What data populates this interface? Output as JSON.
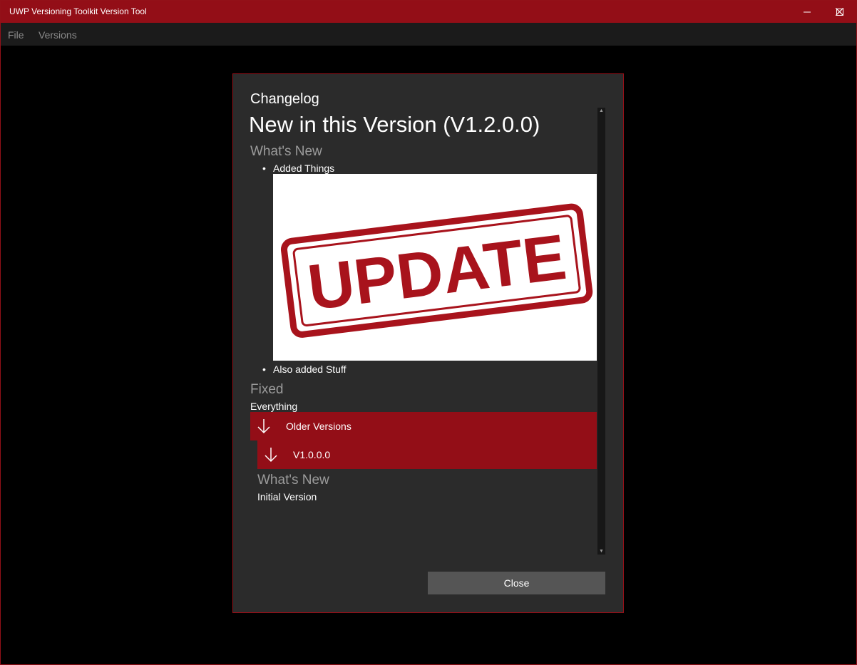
{
  "window": {
    "title": "UWP Versioning Toolkit Version Tool",
    "controls": {
      "minimize": "—",
      "maximize": "☐",
      "close": "✕"
    }
  },
  "menu": {
    "items": [
      "File",
      "Versions"
    ]
  },
  "dialog": {
    "title": "Changelog",
    "current": {
      "heading": "New in this Version (V1.2.0.0)",
      "whats_new_label": "What's New",
      "items": [
        "Added Things",
        "Also added Stuff"
      ],
      "image": {
        "text": "UPDATE"
      },
      "fixed_label": "Fixed",
      "fixed_text": "Everything"
    },
    "older": {
      "label": "Older Versions",
      "version": {
        "label": "V1.0.0.0",
        "whats_new_label": "What's New",
        "text": "Initial Version"
      }
    },
    "close_label": "Close"
  },
  "colors": {
    "accent": "#930e17",
    "dialog_bg": "#2b2b2b",
    "muted": "#9b9b9b",
    "button": "#555555"
  }
}
